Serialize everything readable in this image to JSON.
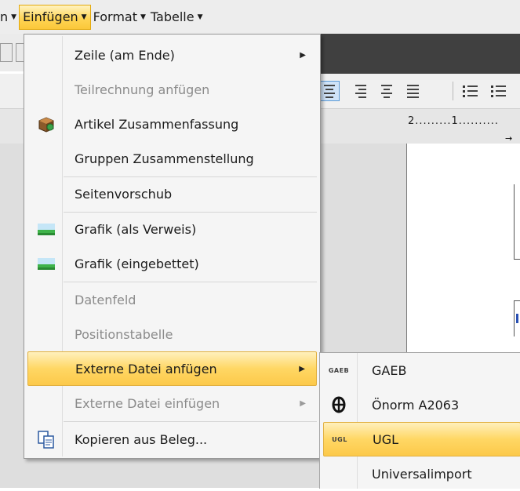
{
  "menubar": {
    "items": [
      {
        "label": "n",
        "active": false
      },
      {
        "label": "Einfügen",
        "active": true
      },
      {
        "label": "Format",
        "active": false
      },
      {
        "label": "Tabelle",
        "active": false
      }
    ]
  },
  "ruler": {
    "text": "2.........1.........."
  },
  "menu": {
    "items": [
      {
        "label": "Zeile (am Ende)",
        "disabled": false,
        "submenu": true,
        "icon": ""
      },
      {
        "label": "Teilrechnung anfügen",
        "disabled": true,
        "submenu": false,
        "icon": ""
      },
      {
        "label": "Artikel Zusammenfassung",
        "disabled": false,
        "submenu": false,
        "icon": "package-icon"
      },
      {
        "label": "Gruppen Zusammenstellung",
        "disabled": false,
        "submenu": false,
        "icon": ""
      },
      {
        "label": "Seitenvorschub",
        "disabled": false,
        "submenu": false,
        "icon": ""
      },
      {
        "label": "Grafik (als Verweis)",
        "disabled": false,
        "submenu": false,
        "icon": "image-icon"
      },
      {
        "label": "Grafik (eingebettet)",
        "disabled": false,
        "submenu": false,
        "icon": "image-icon"
      },
      {
        "label": "Datenfeld",
        "disabled": true,
        "submenu": false,
        "icon": ""
      },
      {
        "label": "Positionstabelle",
        "disabled": true,
        "submenu": false,
        "icon": ""
      },
      {
        "label": "Externe Datei anfügen",
        "disabled": false,
        "submenu": true,
        "icon": "",
        "highlighted": true
      },
      {
        "label": "Externe Datei einfügen",
        "disabled": true,
        "submenu": true,
        "icon": ""
      },
      {
        "label": "Kopieren aus Beleg...",
        "disabled": false,
        "submenu": false,
        "icon": "copy-document-icon"
      }
    ]
  },
  "submenu": {
    "items": [
      {
        "label": "GAEB",
        "icon_text": "GAEB",
        "icon": "gaeb-icon"
      },
      {
        "label": "Önorm A2063",
        "icon_text": "",
        "icon": "onorm-icon"
      },
      {
        "label": "UGL",
        "icon_text": "UGL",
        "icon": "ugl-icon",
        "highlighted": true
      },
      {
        "label": "Universalimport",
        "icon_text": "",
        "icon": ""
      }
    ]
  }
}
